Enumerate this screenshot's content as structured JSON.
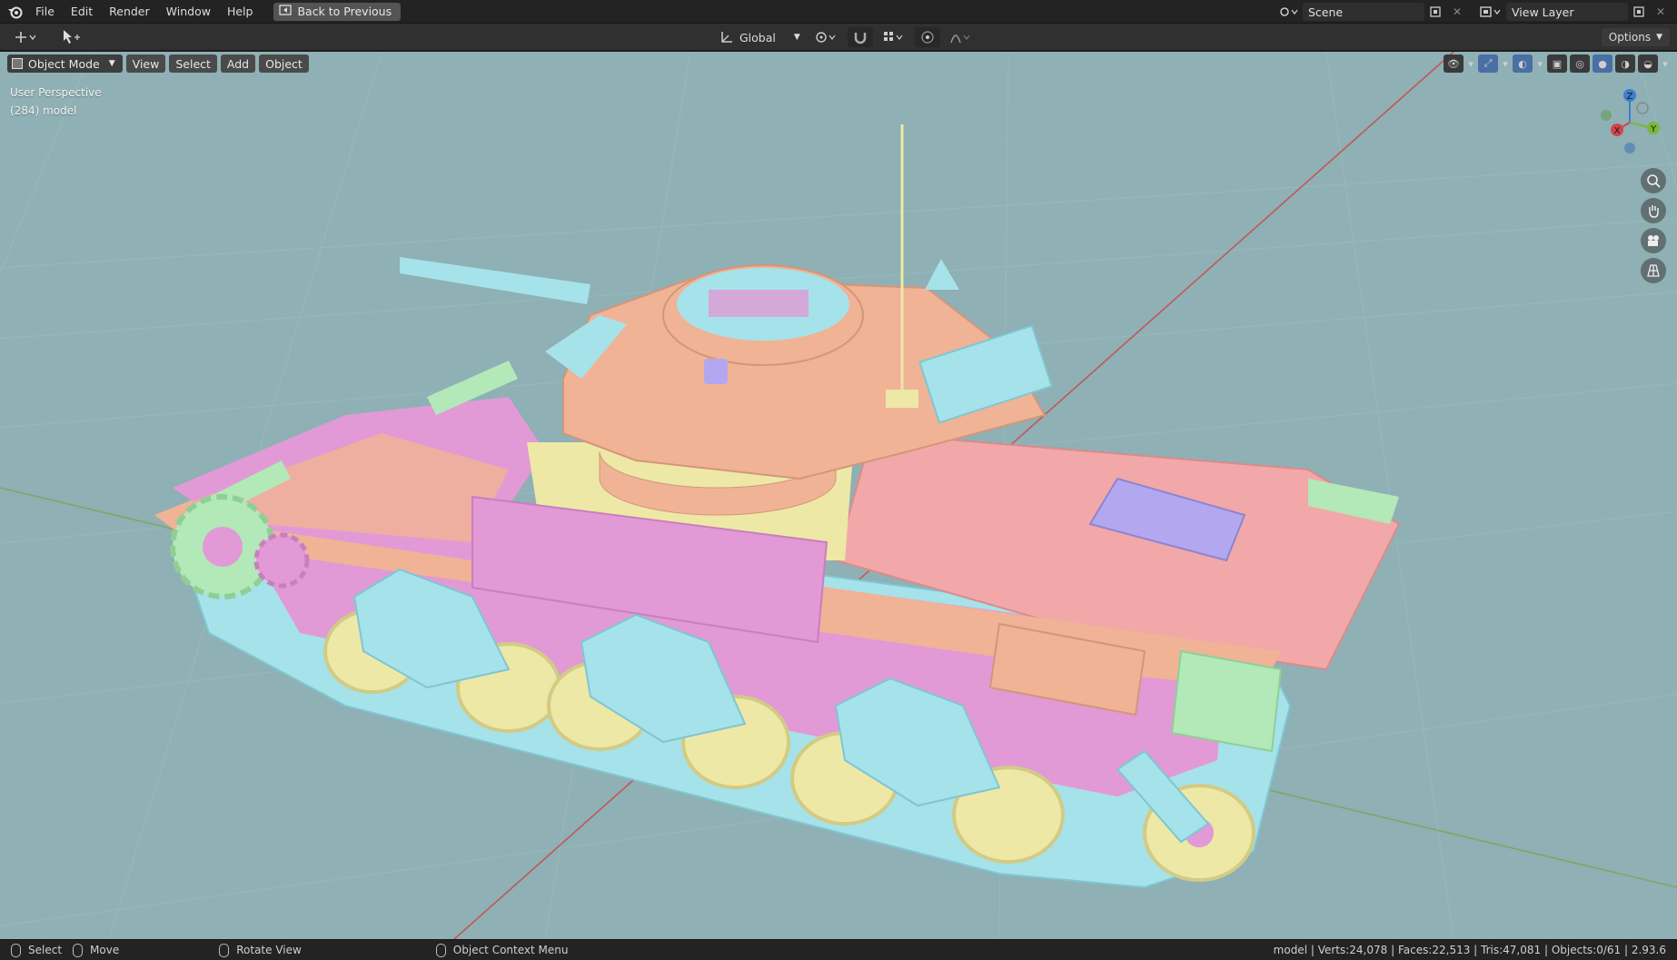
{
  "topbar": {
    "menu": [
      "File",
      "Edit",
      "Render",
      "Window",
      "Help"
    ],
    "back_button": "Back to Previous",
    "scene_name": "Scene",
    "view_layer": "View Layer"
  },
  "tool_header": {
    "transform_orientation": "Global",
    "options_label": "Options"
  },
  "viewport": {
    "mode": "Object Mode",
    "menus": [
      "View",
      "Select",
      "Add",
      "Object"
    ],
    "overlay_line1": "User Perspective",
    "overlay_line2": "(284) model",
    "background_color": "#8fb0b4",
    "gizmo_axes": [
      "Z",
      "Y",
      "X"
    ]
  },
  "model_colors": {
    "pink": "#f2a8a8",
    "magenta": "#e19ad6",
    "cyan": "#a6e2ea",
    "yellow": "#eee8a6",
    "green": "#b3e8b8",
    "lavender": "#b3a8f0",
    "turret": "#f0b396"
  },
  "statusbar": {
    "select": "Select",
    "move": "Move",
    "rotate": "Rotate View",
    "context": "Object Context Menu",
    "stats": "model | Verts:24,078 | Faces:22,513 | Tris:47,081 | Objects:0/61 | 2.93.6"
  }
}
